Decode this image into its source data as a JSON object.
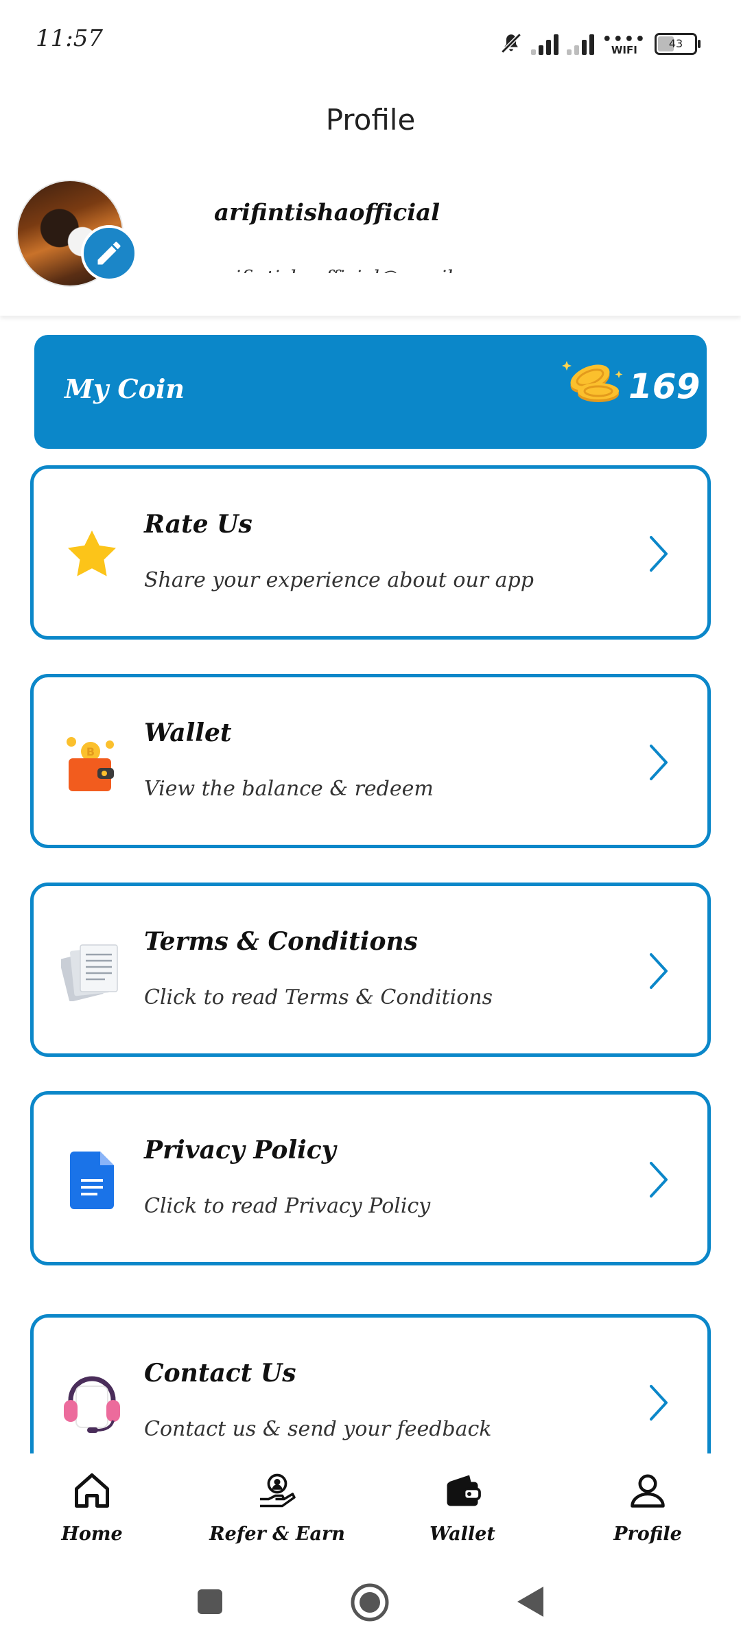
{
  "status_bar": {
    "time": "11:57",
    "wifi_label": "WIFI",
    "battery": "43"
  },
  "header": {
    "title": "Profile",
    "username": "arifintishaofficial",
    "email": "arifintishaofficial@gmail.com"
  },
  "coins": {
    "label": "My Coin",
    "value": "169"
  },
  "menu": [
    {
      "title": "Rate Us",
      "subtitle": "Share your experience about our app",
      "icon": "star-icon"
    },
    {
      "title": "Wallet",
      "subtitle": "View the balance & redeem",
      "icon": "wallet-coin-icon"
    },
    {
      "title": "Terms & Conditions",
      "subtitle": "Click to read Terms & Conditions",
      "icon": "documents-icon"
    },
    {
      "title": "Privacy Policy",
      "subtitle": "Click to read Privacy Policy",
      "icon": "doc-file-icon"
    },
    {
      "title": "Contact Us",
      "subtitle": "Contact us & send your feedback",
      "icon": "headset-icon"
    }
  ],
  "bottom_nav": [
    {
      "label": "Home",
      "icon": "home-icon"
    },
    {
      "label": "Refer & Earn",
      "icon": "refer-icon"
    },
    {
      "label": "Wallet",
      "icon": "wallet-icon"
    },
    {
      "label": "Profile",
      "icon": "user-icon",
      "active": true
    }
  ],
  "colors": {
    "accent": "#0b87c9",
    "star": "#fcc419",
    "wallet": "#f25c1e",
    "doc": "#1a73e8"
  }
}
